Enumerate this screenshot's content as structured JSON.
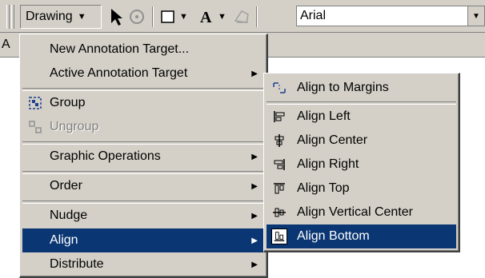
{
  "toolbar": {
    "drawing_label": "Drawing",
    "font_value": "Arial",
    "second_row_letter": "A"
  },
  "menu": {
    "items": [
      {
        "label": "New Annotation Target..."
      },
      {
        "label": "Active Annotation Target"
      },
      {
        "label": "Group"
      },
      {
        "label": "Ungroup"
      },
      {
        "label": "Graphic Operations"
      },
      {
        "label": "Order"
      },
      {
        "label": "Nudge"
      },
      {
        "label": "Align"
      },
      {
        "label": "Distribute"
      }
    ]
  },
  "align_submenu": {
    "items": [
      {
        "label": "Align to Margins"
      },
      {
        "label": "Align Left"
      },
      {
        "label": "Align Center"
      },
      {
        "label": "Align Right"
      },
      {
        "label": "Align Top"
      },
      {
        "label": "Align Vertical Center"
      },
      {
        "label": "Align Bottom"
      }
    ]
  },
  "colors": {
    "face": "#d4d0c8",
    "highlight": "#0a3673"
  }
}
